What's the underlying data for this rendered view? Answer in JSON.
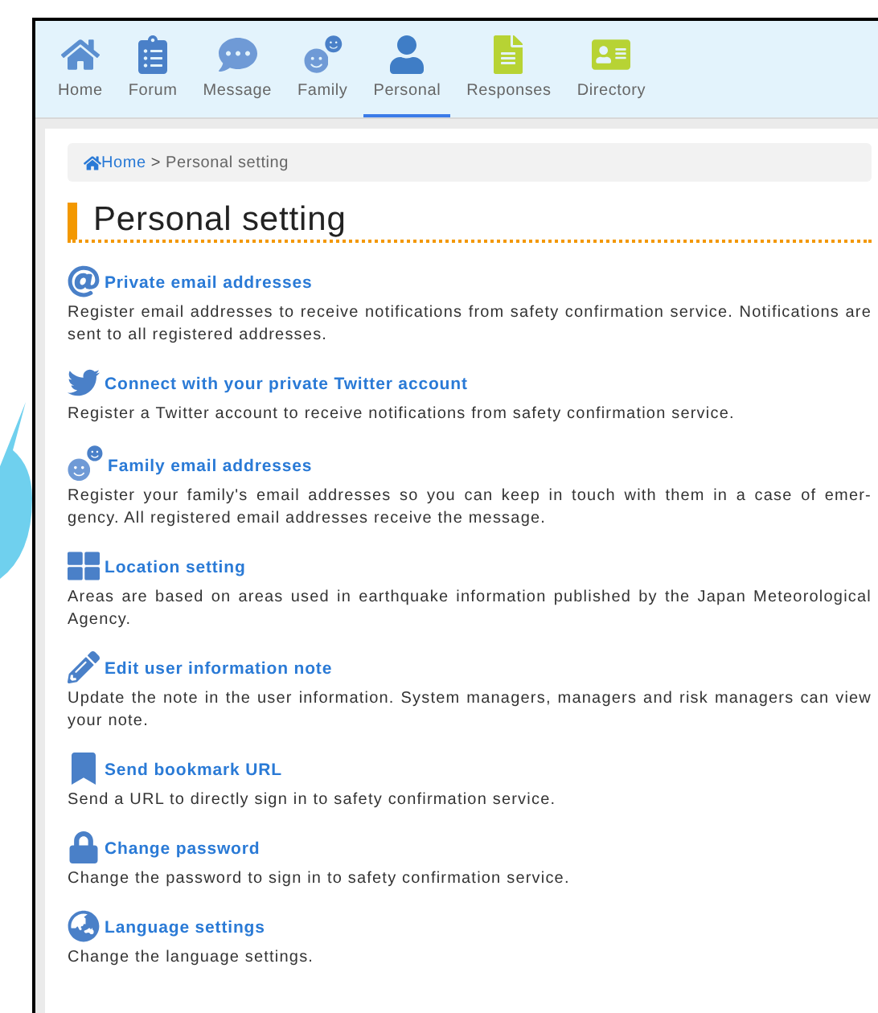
{
  "nav": [
    {
      "kind": "home",
      "label": "Home",
      "selected": false
    },
    {
      "kind": "forum",
      "label": "Forum",
      "selected": false
    },
    {
      "kind": "message",
      "label": "Message",
      "selected": false
    },
    {
      "kind": "family",
      "label": "Family",
      "selected": false
    },
    {
      "kind": "personal",
      "label": "Personal",
      "selected": true
    },
    {
      "kind": "responses",
      "label": "Responses",
      "selected": false
    },
    {
      "kind": "directory",
      "label": "Directory",
      "selected": false
    }
  ],
  "breadcrumb": {
    "home": "Home",
    "separator": ">",
    "current": "Personal setting"
  },
  "heading": "Personal setting",
  "items": [
    {
      "kind": "email",
      "title": "Private email addresses",
      "description": "Register email addresses to receive notifications from safety confirmation service. Notifications are sent to all registered addresses."
    },
    {
      "kind": "twitter",
      "title": "Connect with your private Twitter account",
      "description": "Register a Twitter account to receive notifications from safety confirmation service."
    },
    {
      "kind": "family",
      "title": "Family email addresses",
      "description": "Register your family's email addresses so you can keep in touch with them in a case of emer-gency. All registered email addresses receive the message."
    },
    {
      "kind": "location",
      "title": "Location setting",
      "description": "Areas are based on areas used in earthquake information published by the Japan Meteorological Agency."
    },
    {
      "kind": "note",
      "title": "Edit user information note",
      "description": "Update the note in the user information. System managers, managers and risk managers can view your note."
    },
    {
      "kind": "bookmark",
      "title": "Send bookmark URL",
      "description": "Send a URL to directly sign in to safety confirmation service."
    },
    {
      "kind": "password",
      "title": "Change password",
      "description": "Change the password to sign in to safety confirmation service."
    },
    {
      "kind": "language",
      "title": "Language settings",
      "description": "Change the language settings."
    }
  ]
}
